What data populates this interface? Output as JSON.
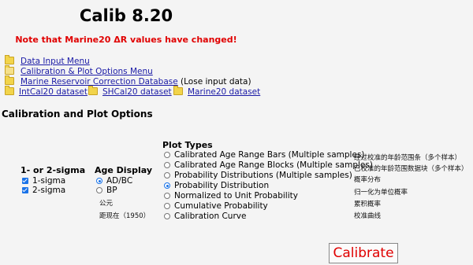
{
  "header": {
    "title": "Calib 8.20",
    "notice": "Note that Marine20 ΔR values have changed!"
  },
  "menu": {
    "data_input": "Data Input Menu",
    "calibration_plot": "Calibration & Plot Options Menu",
    "marine_db": "Marine Reservoir Correction Database",
    "marine_db_note": "(Lose input data)"
  },
  "datasets": [
    "IntCal20 dataset",
    "SHCal20 dataset",
    "Marine20 dataset"
  ],
  "section_title": "Calibration and Plot Options",
  "sigma": {
    "heading": "1- or 2-sigma",
    "options": [
      "1-sigma",
      "2-sigma"
    ]
  },
  "age_display": {
    "heading": "Age Display",
    "options": [
      "AD/BC",
      "BP"
    ],
    "selected": "AD/BC",
    "cn_labels": [
      "公元",
      "距现在（1950）"
    ]
  },
  "plot_types": {
    "heading": "Plot Types",
    "options": [
      "Calibrated Age Range Bars (Multiple samples)",
      "Calibrated Age Range Blocks (Multiple samples)",
      "Probability Distributions (Multiple samples)",
      "Probability Distribution",
      "Normalized to Unit Probability",
      "Cumulative Probability",
      "Calibration Curve"
    ],
    "selected": "Probability Distribution",
    "cn_labels": [
      "经过校准的年龄范围条（多个样本）",
      "已校准的年龄范围数据块（多个样本）",
      "概率分布",
      "归一化为单位概率",
      "累积概率",
      "校准曲线"
    ]
  },
  "calibrate_button": "Calibrate"
}
